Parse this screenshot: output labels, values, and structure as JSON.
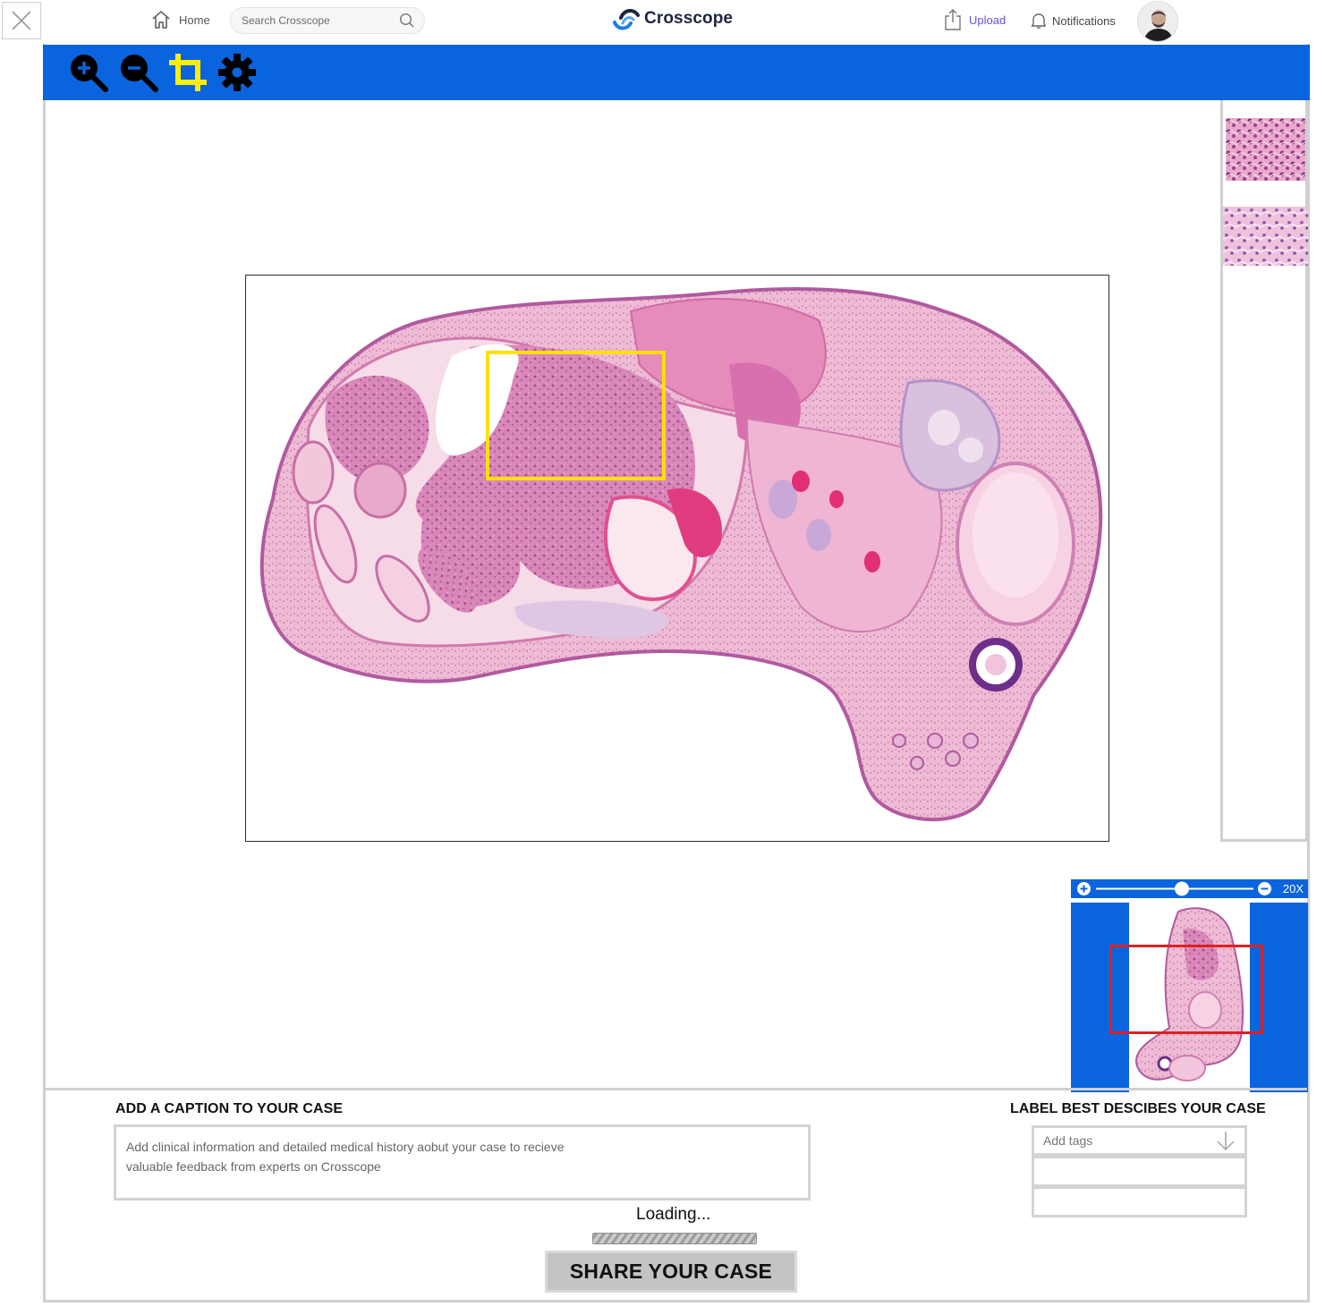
{
  "topnav": {
    "home_label": "Home",
    "search_placeholder": "Search Crosscope",
    "brand_name": "Crosscope",
    "upload_label": "Upload",
    "notifications_label": "Notifications"
  },
  "toolbar": {
    "tools": [
      {
        "name": "zoom-in-icon"
      },
      {
        "name": "zoom-out-icon"
      },
      {
        "name": "crop-icon"
      },
      {
        "name": "gear-icon"
      }
    ],
    "background_color": "#0a64de",
    "crop_color": "#ffee00"
  },
  "viewer": {
    "selection_color": "#ffe000"
  },
  "navigator": {
    "zoom_label": "20X",
    "zoom_level": 0.55,
    "viewport_color": "#e0201e"
  },
  "caption": {
    "title": "ADD A CAPTION TO YOUR CASE",
    "placeholder_line1": "Add clinical information and detailed medical history aobut your case to recieve",
    "placeholder_line2": "valuable feedback from experts on Crosscope"
  },
  "labels": {
    "title": "LABEL BEST DESCIBES YOUR CASE",
    "tags_placeholder": "Add tags"
  },
  "status": {
    "loading_text": "Loading...",
    "progress": 1.0
  },
  "share_button_label": "SHARE YOUR CASE"
}
